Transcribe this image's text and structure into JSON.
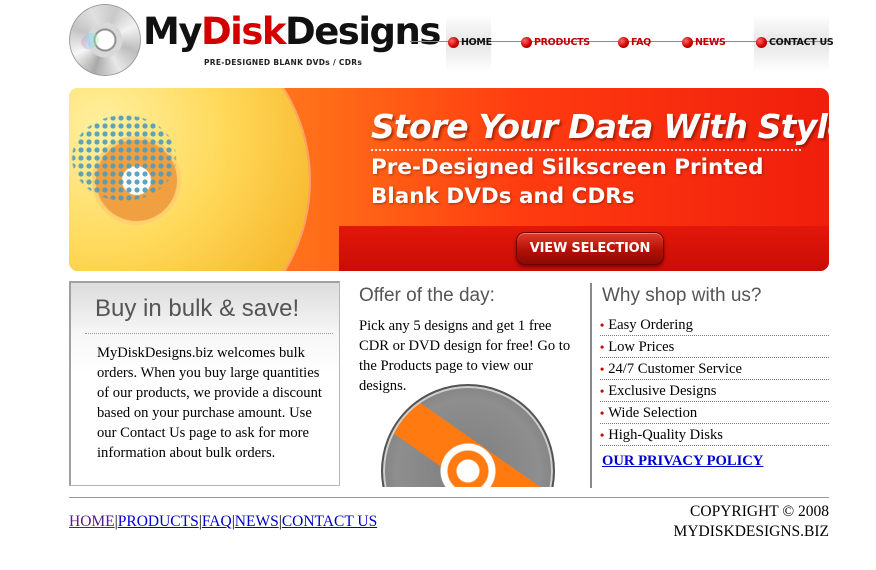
{
  "header": {
    "logo_prefix": "My",
    "logo_red": "Disk",
    "logo_suffix": "Designs",
    "tagline": "PRE-DESIGNED BLANK DVDs / CDRs"
  },
  "nav": {
    "items": [
      {
        "label": "HOME"
      },
      {
        "label": "PRODUCTS"
      },
      {
        "label": "FAQ"
      },
      {
        "label": "NEWS"
      },
      {
        "label": "CONTACT US"
      }
    ]
  },
  "banner": {
    "title": "Store Your Data With Style!",
    "subtitle_line1": "Pre-Designed Silkscreen Printed",
    "subtitle_line2": "Blank DVDs and CDRs",
    "button_label": "VIEW SELECTION"
  },
  "bulk": {
    "heading": "Buy in bulk & save!",
    "body": "MyDiskDesigns.biz welcomes bulk orders. When you buy large quantities of our products, we provide a discount based on your purchase amount. Use our Contact Us page to ask for more information about bulk orders."
  },
  "offer": {
    "heading": "Offer of the day:",
    "body": "Pick any 5 designs and get 1 free CDR or DVD design for free! Go to the Products page to view our designs."
  },
  "why": {
    "heading": "Why shop with us?",
    "bullet": "•",
    "reasons": [
      "Easy Ordering",
      "Low Prices",
      "24/7 Customer Service",
      "Exclusive Designs",
      "Wide Selection",
      "High-Quality Disks"
    ],
    "privacy_link": "OUR PRIVACY POLICY"
  },
  "footer": {
    "links": [
      "HOME",
      "PRODUCTS",
      "FAQ",
      "NEWS",
      "CONTACT US"
    ],
    "separator": "|",
    "copyright_line1": "COPYRIGHT © 2008",
    "copyright_line2": "MYDISKDESIGNS.BIZ"
  },
  "colors": {
    "brand_red": "#d40000",
    "banner_orange": "#ff6a17",
    "link_blue": "#0000cc",
    "link_visited": "#551a8b"
  }
}
